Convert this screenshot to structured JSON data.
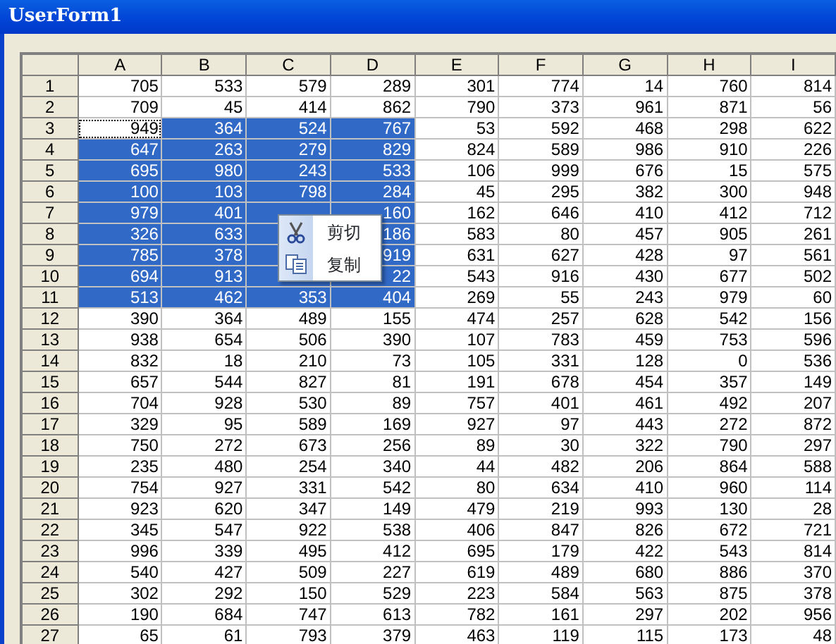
{
  "window": {
    "title": "UserForm1"
  },
  "grid": {
    "columns": [
      "A",
      "B",
      "C",
      "D",
      "E",
      "F",
      "G",
      "H",
      "I"
    ],
    "rows": [
      {
        "header": "1",
        "cells": [
          {
            "text": "705",
            "selected": false
          },
          {
            "text": "533",
            "selected": false
          },
          {
            "text": "579",
            "selected": false
          },
          {
            "text": "289",
            "selected": false
          },
          {
            "text": "301",
            "selected": false
          },
          {
            "text": "774",
            "selected": false
          },
          {
            "text": "14",
            "selected": false
          },
          {
            "text": "760",
            "selected": false
          },
          {
            "text": "814",
            "selected": false
          }
        ]
      },
      {
        "header": "2",
        "cells": [
          {
            "text": "709",
            "selected": false
          },
          {
            "text": "45",
            "selected": false
          },
          {
            "text": "414",
            "selected": false
          },
          {
            "text": "862",
            "selected": false
          },
          {
            "text": "790",
            "selected": false
          },
          {
            "text": "373",
            "selected": false
          },
          {
            "text": "961",
            "selected": false
          },
          {
            "text": "871",
            "selected": false
          },
          {
            "text": "56",
            "selected": false
          }
        ]
      },
      {
        "header": "3",
        "cells": [
          {
            "text": "949",
            "focused": true
          },
          {
            "text": "364",
            "selected": true
          },
          {
            "text": "524",
            "selected": true
          },
          {
            "text": "767",
            "selected": true
          },
          {
            "text": "53",
            "selected": false
          },
          {
            "text": "592",
            "selected": false
          },
          {
            "text": "468",
            "selected": false
          },
          {
            "text": "298",
            "selected": false
          },
          {
            "text": "622",
            "selected": false
          }
        ]
      },
      {
        "header": "4",
        "cells": [
          {
            "text": "647",
            "selected": true
          },
          {
            "text": "263",
            "selected": true
          },
          {
            "text": "279",
            "selected": true
          },
          {
            "text": "829",
            "selected": true
          },
          {
            "text": "824",
            "selected": false
          },
          {
            "text": "589",
            "selected": false
          },
          {
            "text": "986",
            "selected": false
          },
          {
            "text": "910",
            "selected": false
          },
          {
            "text": "226",
            "selected": false
          }
        ]
      },
      {
        "header": "5",
        "cells": [
          {
            "text": "695",
            "selected": true
          },
          {
            "text": "980",
            "selected": true
          },
          {
            "text": "243",
            "selected": true
          },
          {
            "text": "533",
            "selected": true
          },
          {
            "text": "106",
            "selected": false
          },
          {
            "text": "999",
            "selected": false
          },
          {
            "text": "676",
            "selected": false
          },
          {
            "text": "15",
            "selected": false
          },
          {
            "text": "575",
            "selected": false
          }
        ]
      },
      {
        "header": "6",
        "cells": [
          {
            "text": "100",
            "selected": true
          },
          {
            "text": "103",
            "selected": true
          },
          {
            "text": "798",
            "selected": true
          },
          {
            "text": "284",
            "selected": true
          },
          {
            "text": "45",
            "selected": false
          },
          {
            "text": "295",
            "selected": false
          },
          {
            "text": "382",
            "selected": false
          },
          {
            "text": "300",
            "selected": false
          },
          {
            "text": "948",
            "selected": false
          }
        ]
      },
      {
        "header": "7",
        "cells": [
          {
            "text": "979",
            "selected": true
          },
          {
            "text": "401",
            "selected": true
          },
          {
            "selected": true
          },
          {
            "text": "160",
            "selected": true
          },
          {
            "text": "162",
            "selected": false
          },
          {
            "text": "646",
            "selected": false
          },
          {
            "text": "410",
            "selected": false
          },
          {
            "text": "412",
            "selected": false
          },
          {
            "text": "712",
            "selected": false
          }
        ]
      },
      {
        "header": "8",
        "cells": [
          {
            "text": "326",
            "selected": true
          },
          {
            "text": "633",
            "selected": true
          },
          {
            "selected": true
          },
          {
            "text": "186",
            "selected": true
          },
          {
            "text": "583",
            "selected": false
          },
          {
            "text": "80",
            "selected": false
          },
          {
            "text": "457",
            "selected": false
          },
          {
            "text": "905",
            "selected": false
          },
          {
            "text": "261",
            "selected": false
          }
        ]
      },
      {
        "header": "9",
        "cells": [
          {
            "text": "785",
            "selected": true
          },
          {
            "text": "378",
            "selected": true
          },
          {
            "selected": true
          },
          {
            "text": "919",
            "selected": true
          },
          {
            "text": "631",
            "selected": false
          },
          {
            "text": "627",
            "selected": false
          },
          {
            "text": "428",
            "selected": false
          },
          {
            "text": "97",
            "selected": false
          },
          {
            "text": "561",
            "selected": false
          }
        ]
      },
      {
        "header": "10",
        "cells": [
          {
            "text": "694",
            "selected": true
          },
          {
            "text": "913",
            "selected": true
          },
          {
            "selected": true
          },
          {
            "text": "22",
            "selected": true
          },
          {
            "text": "543",
            "selected": false
          },
          {
            "text": "916",
            "selected": false
          },
          {
            "text": "430",
            "selected": false
          },
          {
            "text": "677",
            "selected": false
          },
          {
            "text": "502",
            "selected": false
          }
        ]
      },
      {
        "header": "11",
        "cells": [
          {
            "text": "513",
            "selected": true
          },
          {
            "text": "462",
            "selected": true
          },
          {
            "text": "353",
            "selected": true
          },
          {
            "text": "404",
            "selected": true
          },
          {
            "text": "269",
            "selected": false
          },
          {
            "text": "55",
            "selected": false
          },
          {
            "text": "243",
            "selected": false
          },
          {
            "text": "979",
            "selected": false
          },
          {
            "text": "60",
            "selected": false
          }
        ]
      },
      {
        "header": "12",
        "cells": [
          {
            "text": "390",
            "selected": false
          },
          {
            "text": "364",
            "selected": false
          },
          {
            "text": "489",
            "selected": false
          },
          {
            "text": "155",
            "selected": false
          },
          {
            "text": "474",
            "selected": false
          },
          {
            "text": "257",
            "selected": false
          },
          {
            "text": "628",
            "selected": false
          },
          {
            "text": "542",
            "selected": false
          },
          {
            "text": "156",
            "selected": false
          }
        ]
      },
      {
        "header": "13",
        "cells": [
          {
            "text": "938",
            "selected": false
          },
          {
            "text": "654",
            "selected": false
          },
          {
            "text": "506",
            "selected": false
          },
          {
            "text": "390",
            "selected": false
          },
          {
            "text": "107",
            "selected": false
          },
          {
            "text": "783",
            "selected": false
          },
          {
            "text": "459",
            "selected": false
          },
          {
            "text": "753",
            "selected": false
          },
          {
            "text": "596",
            "selected": false
          }
        ]
      },
      {
        "header": "14",
        "cells": [
          {
            "text": "832",
            "selected": false
          },
          {
            "text": "18",
            "selected": false
          },
          {
            "text": "210",
            "selected": false
          },
          {
            "text": "73",
            "selected": false
          },
          {
            "text": "105",
            "selected": false
          },
          {
            "text": "331",
            "selected": false
          },
          {
            "text": "128",
            "selected": false
          },
          {
            "text": "0",
            "selected": false
          },
          {
            "text": "536",
            "selected": false
          }
        ]
      },
      {
        "header": "15",
        "cells": [
          {
            "text": "657",
            "selected": false
          },
          {
            "text": "544",
            "selected": false
          },
          {
            "text": "827",
            "selected": false
          },
          {
            "text": "81",
            "selected": false
          },
          {
            "text": "191",
            "selected": false
          },
          {
            "text": "678",
            "selected": false
          },
          {
            "text": "454",
            "selected": false
          },
          {
            "text": "357",
            "selected": false
          },
          {
            "text": "149",
            "selected": false
          }
        ]
      },
      {
        "header": "16",
        "cells": [
          {
            "text": "704",
            "selected": false
          },
          {
            "text": "928",
            "selected": false
          },
          {
            "text": "530",
            "selected": false
          },
          {
            "text": "89",
            "selected": false
          },
          {
            "text": "757",
            "selected": false
          },
          {
            "text": "401",
            "selected": false
          },
          {
            "text": "461",
            "selected": false
          },
          {
            "text": "492",
            "selected": false
          },
          {
            "text": "207",
            "selected": false
          }
        ]
      },
      {
        "header": "17",
        "cells": [
          {
            "text": "329",
            "selected": false
          },
          {
            "text": "95",
            "selected": false
          },
          {
            "text": "589",
            "selected": false
          },
          {
            "text": "169",
            "selected": false
          },
          {
            "text": "927",
            "selected": false
          },
          {
            "text": "97",
            "selected": false
          },
          {
            "text": "443",
            "selected": false
          },
          {
            "text": "272",
            "selected": false
          },
          {
            "text": "872",
            "selected": false
          }
        ]
      },
      {
        "header": "18",
        "cells": [
          {
            "text": "750",
            "selected": false
          },
          {
            "text": "272",
            "selected": false
          },
          {
            "text": "673",
            "selected": false
          },
          {
            "text": "256",
            "selected": false
          },
          {
            "text": "89",
            "selected": false
          },
          {
            "text": "30",
            "selected": false
          },
          {
            "text": "322",
            "selected": false
          },
          {
            "text": "790",
            "selected": false
          },
          {
            "text": "297",
            "selected": false
          }
        ]
      },
      {
        "header": "19",
        "cells": [
          {
            "text": "235",
            "selected": false
          },
          {
            "text": "480",
            "selected": false
          },
          {
            "text": "254",
            "selected": false
          },
          {
            "text": "340",
            "selected": false
          },
          {
            "text": "44",
            "selected": false
          },
          {
            "text": "482",
            "selected": false
          },
          {
            "text": "206",
            "selected": false
          },
          {
            "text": "864",
            "selected": false
          },
          {
            "text": "588",
            "selected": false
          }
        ]
      },
      {
        "header": "20",
        "cells": [
          {
            "text": "754",
            "selected": false
          },
          {
            "text": "927",
            "selected": false
          },
          {
            "text": "331",
            "selected": false
          },
          {
            "text": "542",
            "selected": false
          },
          {
            "text": "80",
            "selected": false
          },
          {
            "text": "634",
            "selected": false
          },
          {
            "text": "410",
            "selected": false
          },
          {
            "text": "960",
            "selected": false
          },
          {
            "text": "114",
            "selected": false
          }
        ]
      },
      {
        "header": "21",
        "cells": [
          {
            "text": "923",
            "selected": false
          },
          {
            "text": "620",
            "selected": false
          },
          {
            "text": "347",
            "selected": false
          },
          {
            "text": "149",
            "selected": false
          },
          {
            "text": "479",
            "selected": false
          },
          {
            "text": "219",
            "selected": false
          },
          {
            "text": "993",
            "selected": false
          },
          {
            "text": "130",
            "selected": false
          },
          {
            "text": "28",
            "selected": false
          }
        ]
      },
      {
        "header": "22",
        "cells": [
          {
            "text": "345",
            "selected": false
          },
          {
            "text": "547",
            "selected": false
          },
          {
            "text": "922",
            "selected": false
          },
          {
            "text": "538",
            "selected": false
          },
          {
            "text": "406",
            "selected": false
          },
          {
            "text": "847",
            "selected": false
          },
          {
            "text": "826",
            "selected": false
          },
          {
            "text": "672",
            "selected": false
          },
          {
            "text": "721",
            "selected": false
          }
        ]
      },
      {
        "header": "23",
        "cells": [
          {
            "text": "996",
            "selected": false
          },
          {
            "text": "339",
            "selected": false
          },
          {
            "text": "495",
            "selected": false
          },
          {
            "text": "412",
            "selected": false
          },
          {
            "text": "695",
            "selected": false
          },
          {
            "text": "179",
            "selected": false
          },
          {
            "text": "422",
            "selected": false
          },
          {
            "text": "543",
            "selected": false
          },
          {
            "text": "814",
            "selected": false
          }
        ]
      },
      {
        "header": "24",
        "cells": [
          {
            "text": "540",
            "selected": false
          },
          {
            "text": "427",
            "selected": false
          },
          {
            "text": "509",
            "selected": false
          },
          {
            "text": "227",
            "selected": false
          },
          {
            "text": "619",
            "selected": false
          },
          {
            "text": "489",
            "selected": false
          },
          {
            "text": "680",
            "selected": false
          },
          {
            "text": "886",
            "selected": false
          },
          {
            "text": "370",
            "selected": false
          }
        ]
      },
      {
        "header": "25",
        "cells": [
          {
            "text": "302",
            "selected": false
          },
          {
            "text": "292",
            "selected": false
          },
          {
            "text": "150",
            "selected": false
          },
          {
            "text": "529",
            "selected": false
          },
          {
            "text": "223",
            "selected": false
          },
          {
            "text": "584",
            "selected": false
          },
          {
            "text": "563",
            "selected": false
          },
          {
            "text": "875",
            "selected": false
          },
          {
            "text": "378",
            "selected": false
          }
        ]
      },
      {
        "header": "26",
        "cells": [
          {
            "text": "190",
            "selected": false
          },
          {
            "text": "684",
            "selected": false
          },
          {
            "text": "747",
            "selected": false
          },
          {
            "text": "613",
            "selected": false
          },
          {
            "text": "782",
            "selected": false
          },
          {
            "text": "161",
            "selected": false
          },
          {
            "text": "297",
            "selected": false
          },
          {
            "text": "202",
            "selected": false
          },
          {
            "text": "956",
            "selected": false
          }
        ]
      },
      {
        "header": "27",
        "cells": [
          {
            "text": "65",
            "selected": false
          },
          {
            "text": "61",
            "selected": false
          },
          {
            "text": "793",
            "selected": false
          },
          {
            "text": "379",
            "selected": false
          },
          {
            "text": "463",
            "selected": false
          },
          {
            "text": "119",
            "selected": false
          },
          {
            "text": "115",
            "selected": false
          },
          {
            "text": "173",
            "selected": false
          },
          {
            "text": "48",
            "selected": false
          }
        ]
      }
    ]
  },
  "context_menu": {
    "items": [
      {
        "kind": "cut",
        "label": "剪切"
      },
      {
        "kind": "copy",
        "label": "复制"
      }
    ]
  }
}
